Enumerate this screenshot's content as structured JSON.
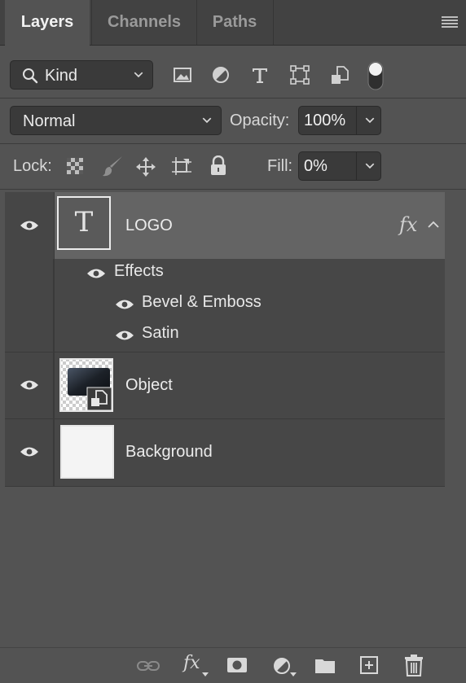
{
  "tabs": [
    {
      "label": "Layers",
      "active": true
    },
    {
      "label": "Channels",
      "active": false
    },
    {
      "label": "Paths",
      "active": false
    }
  ],
  "filter": {
    "kind_label": "Kind",
    "icons": [
      "image-filter-icon",
      "adjustment-filter-icon",
      "type-filter-icon",
      "shape-filter-icon",
      "smart-object-filter-icon",
      "filter-toggle-icon"
    ]
  },
  "blend": {
    "mode": "Normal",
    "opacity_label": "Opacity:",
    "opacity_value": "100%"
  },
  "lock": {
    "label": "Lock:",
    "icons": [
      "lock-transparent-pixels-icon",
      "lock-image-pixels-icon",
      "lock-position-icon",
      "lock-artboard-icon",
      "lock-all-icon"
    ],
    "fill_label": "Fill:",
    "fill_value": "0%"
  },
  "layers": [
    {
      "name": "LOGO",
      "type": "text",
      "thumb_glyph": "T",
      "visible": true,
      "fx": "fx",
      "effects_label": "Effects",
      "effects": [
        "Bevel & Emboss",
        "Satin"
      ]
    },
    {
      "name": "Object",
      "type": "smart-object",
      "visible": true
    },
    {
      "name": "Background",
      "type": "pixel",
      "visible": true
    }
  ],
  "bottom_bar": {
    "fx_label": "fx",
    "icons": [
      "link-layers-icon",
      "add-style-icon",
      "add-mask-icon",
      "new-adjustment-icon",
      "new-group-icon",
      "new-layer-icon",
      "delete-layer-icon"
    ]
  },
  "colors": {
    "panel": "#535353",
    "tabbar": "#424242",
    "selected_row": "#646464",
    "row": "#474747"
  }
}
